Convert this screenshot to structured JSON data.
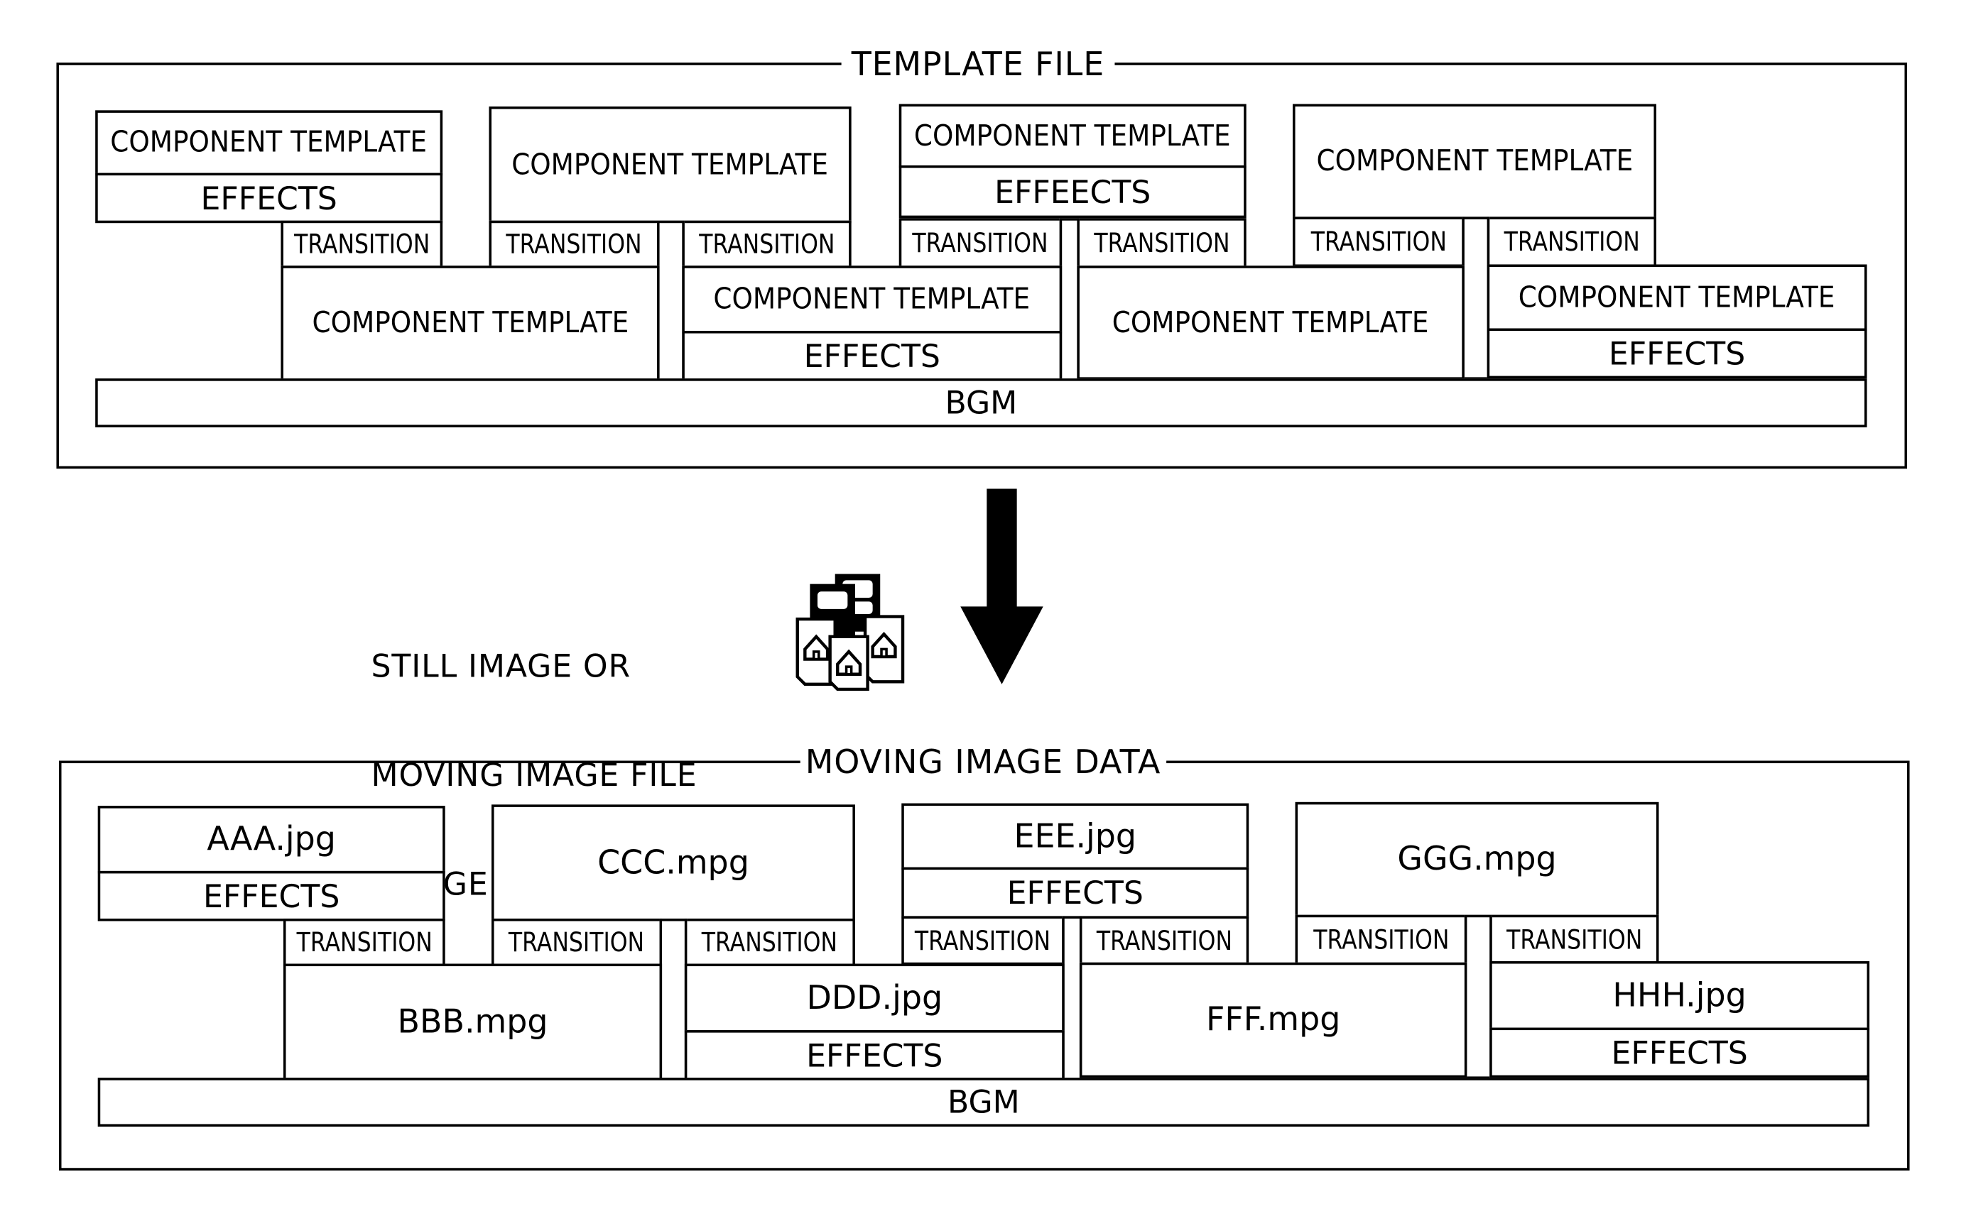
{
  "template_panel": {
    "title": "TEMPLATE FILE",
    "top_row": [
      {
        "main": "COMPONENT TEMPLATE",
        "effects": "EFFECTS"
      },
      {
        "main": "COMPONENT TEMPLATE"
      },
      {
        "main": "COMPONENT TEMPLATE",
        "effects": "EFFEECTS"
      },
      {
        "main": "COMPONENT TEMPLATE"
      }
    ],
    "bottom_row": [
      {
        "main": "COMPONENT TEMPLATE"
      },
      {
        "main": "COMPONENT TEMPLATE",
        "effects": "EFFECTS"
      },
      {
        "main": "COMPONENT TEMPLATE"
      },
      {
        "main": "COMPONENT TEMPLATE",
        "effects": "EFFECTS"
      }
    ],
    "transitions": [
      "TRANSITION",
      "TRANSITION",
      "TRANSITION",
      "TRANSITION",
      "TRANSITION",
      "TRANSITION",
      "TRANSITION"
    ],
    "bgm": "BGM"
  },
  "middle": {
    "lines": [
      "STILL IMAGE OR",
      "MOVING IMAGE FILE",
      "(IMAGE COMPONENTS)"
    ],
    "icon": "image-files-icon",
    "arrow": "down-arrow-icon"
  },
  "data_panel": {
    "title": "MOVING IMAGE DATA",
    "top_row": [
      {
        "main": "AAA.jpg",
        "effects": "EFFECTS"
      },
      {
        "main": "CCC.mpg"
      },
      {
        "main": "EEE.jpg",
        "effects": "EFFECTS"
      },
      {
        "main": "GGG.mpg"
      }
    ],
    "bottom_row": [
      {
        "main": "BBB.mpg"
      },
      {
        "main": "DDD.jpg",
        "effects": "EFFECTS"
      },
      {
        "main": "FFF.mpg"
      },
      {
        "main": "HHH.jpg",
        "effects": "EFFECTS"
      }
    ],
    "transitions": [
      "TRANSITION",
      "TRANSITION",
      "TRANSITION",
      "TRANSITION",
      "TRANSITION",
      "TRANSITION",
      "TRANSITION"
    ],
    "bgm": "BGM"
  }
}
